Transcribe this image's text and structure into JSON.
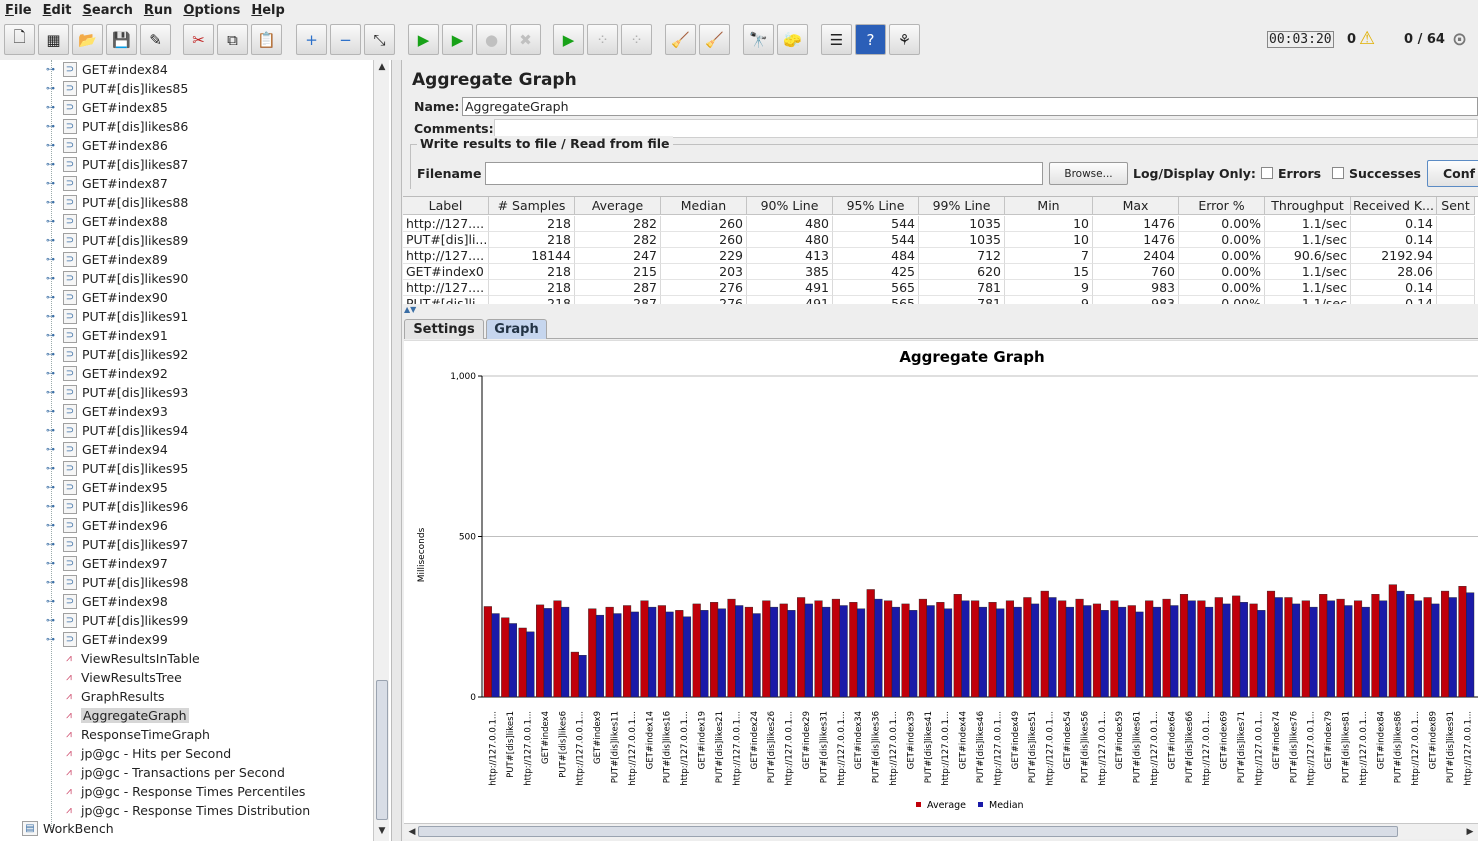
{
  "menu": [
    "File",
    "Edit",
    "Search",
    "Run",
    "Options",
    "Help"
  ],
  "toolbar": {
    "timer": "00:03:20",
    "warnings": "0",
    "threads": "0 / 64",
    "buttons": [
      {
        "name": "new-icon",
        "glyph": "🗋"
      },
      {
        "name": "templates-icon",
        "glyph": "▦"
      },
      {
        "name": "open-icon",
        "glyph": "📂"
      },
      {
        "name": "save-icon",
        "glyph": "💾"
      },
      {
        "name": "save-as-icon",
        "glyph": "✎"
      },
      {
        "name": "cut-icon",
        "glyph": "✂"
      },
      {
        "name": "copy-icon",
        "glyph": "⧉"
      },
      {
        "name": "paste-icon",
        "glyph": "📋"
      },
      {
        "name": "expand-icon",
        "glyph": "+"
      },
      {
        "name": "collapse-icon",
        "glyph": "−"
      },
      {
        "name": "toggle-icon",
        "glyph": "⤡"
      },
      {
        "name": "start-icon",
        "glyph": "▶"
      },
      {
        "name": "start-no-pause-icon",
        "glyph": "▶"
      },
      {
        "name": "stop-icon",
        "glyph": "●"
      },
      {
        "name": "shutdown-icon",
        "glyph": "✖"
      },
      {
        "name": "remote-start-icon",
        "glyph": "▶"
      },
      {
        "name": "remote-stop-icon",
        "glyph": "⁘"
      },
      {
        "name": "remote-shutdown-icon",
        "glyph": "⁘"
      },
      {
        "name": "clear-icon",
        "glyph": "🧹"
      },
      {
        "name": "clear-all-icon",
        "glyph": "🧹"
      },
      {
        "name": "search-icon",
        "glyph": "🔭"
      },
      {
        "name": "reset-search-icon",
        "glyph": "🧽"
      },
      {
        "name": "function-helper-icon",
        "glyph": "☰"
      },
      {
        "name": "help-icon",
        "glyph": "?"
      },
      {
        "name": "log-viewer-icon",
        "glyph": "⚘"
      }
    ]
  },
  "tree": {
    "items": [
      {
        "label": "GET#index84",
        "type": "sampler"
      },
      {
        "label": "PUT#[dis]likes85",
        "type": "sampler"
      },
      {
        "label": "GET#index85",
        "type": "sampler"
      },
      {
        "label": "PUT#[dis]likes86",
        "type": "sampler"
      },
      {
        "label": "GET#index86",
        "type": "sampler"
      },
      {
        "label": "PUT#[dis]likes87",
        "type": "sampler"
      },
      {
        "label": "GET#index87",
        "type": "sampler"
      },
      {
        "label": "PUT#[dis]likes88",
        "type": "sampler"
      },
      {
        "label": "GET#index88",
        "type": "sampler"
      },
      {
        "label": "PUT#[dis]likes89",
        "type": "sampler"
      },
      {
        "label": "GET#index89",
        "type": "sampler"
      },
      {
        "label": "PUT#[dis]likes90",
        "type": "sampler"
      },
      {
        "label": "GET#index90",
        "type": "sampler"
      },
      {
        "label": "PUT#[dis]likes91",
        "type": "sampler"
      },
      {
        "label": "GET#index91",
        "type": "sampler"
      },
      {
        "label": "PUT#[dis]likes92",
        "type": "sampler"
      },
      {
        "label": "GET#index92",
        "type": "sampler"
      },
      {
        "label": "PUT#[dis]likes93",
        "type": "sampler"
      },
      {
        "label": "GET#index93",
        "type": "sampler"
      },
      {
        "label": "PUT#[dis]likes94",
        "type": "sampler"
      },
      {
        "label": "GET#index94",
        "type": "sampler"
      },
      {
        "label": "PUT#[dis]likes95",
        "type": "sampler"
      },
      {
        "label": "GET#index95",
        "type": "sampler"
      },
      {
        "label": "PUT#[dis]likes96",
        "type": "sampler"
      },
      {
        "label": "GET#index96",
        "type": "sampler"
      },
      {
        "label": "PUT#[dis]likes97",
        "type": "sampler"
      },
      {
        "label": "GET#index97",
        "type": "sampler"
      },
      {
        "label": "PUT#[dis]likes98",
        "type": "sampler"
      },
      {
        "label": "GET#index98",
        "type": "sampler"
      },
      {
        "label": "PUT#[dis]likes99",
        "type": "sampler"
      },
      {
        "label": "GET#index99",
        "type": "sampler"
      },
      {
        "label": "ViewResultsInTable",
        "type": "listener"
      },
      {
        "label": "ViewResultsTree",
        "type": "listener"
      },
      {
        "label": "GraphResults",
        "type": "listener"
      },
      {
        "label": "AggregateGraph",
        "type": "listener",
        "selected": true
      },
      {
        "label": "ResponseTimeGraph",
        "type": "listener"
      },
      {
        "label": "jp@gc - Hits per Second",
        "type": "listener"
      },
      {
        "label": "jp@gc - Transactions per Second",
        "type": "listener"
      },
      {
        "label": "jp@gc - Response Times Percentiles",
        "type": "listener"
      },
      {
        "label": "jp@gc - Response Times Distribution",
        "type": "listener"
      }
    ],
    "workbench": "WorkBench"
  },
  "panel": {
    "title": "Aggregate Graph",
    "name_label": "Name:",
    "name_value": "AggregateGraph",
    "comments_label": "Comments:",
    "fileset_legend": "Write results to file / Read from file",
    "filename_label": "Filename",
    "browse_label": "Browse...",
    "log_display_label": "Log/Display Only:",
    "errors_label": "Errors",
    "successes_label": "Successes",
    "configure_label": "Conf"
  },
  "table": {
    "columns": [
      "Label",
      "# Samples",
      "Average",
      "Median",
      "90% Line",
      "95% Line",
      "99% Line",
      "Min",
      "Max",
      "Error %",
      "Throughput",
      "Received K...",
      "Sent"
    ],
    "rows": [
      [
        "http://127....",
        "218",
        "282",
        "260",
        "480",
        "544",
        "1035",
        "10",
        "1476",
        "0.00%",
        "1.1/sec",
        "0.14",
        ""
      ],
      [
        "PUT#[dis]li...",
        "218",
        "282",
        "260",
        "480",
        "544",
        "1035",
        "10",
        "1476",
        "0.00%",
        "1.1/sec",
        "0.14",
        ""
      ],
      [
        "http://127....",
        "18144",
        "247",
        "229",
        "413",
        "484",
        "712",
        "7",
        "2404",
        "0.00%",
        "90.6/sec",
        "2192.94",
        ""
      ],
      [
        "GET#index0",
        "218",
        "215",
        "203",
        "385",
        "425",
        "620",
        "15",
        "760",
        "0.00%",
        "1.1/sec",
        "28.06",
        ""
      ],
      [
        "http://127....",
        "218",
        "287",
        "276",
        "491",
        "565",
        "781",
        "9",
        "983",
        "0.00%",
        "1.1/sec",
        "0.14",
        ""
      ],
      [
        "PUT#[dis]li...",
        "218",
        "287",
        "276",
        "491",
        "565",
        "781",
        "9",
        "983",
        "0.00%",
        "1.1/sec",
        "0.14",
        ""
      ]
    ]
  },
  "tabs": [
    "Settings",
    "Graph"
  ],
  "colors": {
    "average": "#c0000a",
    "median": "#1a1aa8"
  },
  "chart_data": {
    "type": "bar",
    "title": "Aggregate Graph",
    "ylabel": "Milliseconds",
    "ylim": [
      0,
      1000
    ],
    "yticks": [
      "0",
      "500",
      "1,000"
    ],
    "grid": true,
    "legend_position": "bottom",
    "categories": [
      "http://127.0.0.1...",
      "PUT#[dis]likes1",
      "http://127.0.0.1...",
      "GET#index4",
      "PUT#[dis]likes6",
      "http://127.0.0.1...",
      "GET#index9",
      "PUT#[dis]likes11",
      "http://127.0.0.1...",
      "GET#index14",
      "PUT#[dis]likes16",
      "http://127.0.0.1...",
      "GET#index19",
      "PUT#[dis]likes21",
      "http://127.0.0.1...",
      "GET#index24",
      "PUT#[dis]likes26",
      "http://127.0.0.1...",
      "GET#index29",
      "PUT#[dis]likes31",
      "http://127.0.0.1...",
      "GET#index34",
      "PUT#[dis]likes36",
      "http://127.0.0.1...",
      "GET#index39",
      "PUT#[dis]likes41",
      "http://127.0.0.1...",
      "GET#index44",
      "PUT#[dis]likes46",
      "http://127.0.0.1...",
      "GET#index49",
      "PUT#[dis]likes51",
      "http://127.0.0.1...",
      "GET#index54",
      "PUT#[dis]likes56",
      "http://127.0.0.1...",
      "GET#index59",
      "PUT#[dis]likes61",
      "http://127.0.0.1...",
      "GET#index64",
      "PUT#[dis]likes66",
      "http://127.0.0.1...",
      "GET#index69",
      "PUT#[dis]likes71",
      "http://127.0.0.1...",
      "GET#index74",
      "PUT#[dis]likes76",
      "http://127.0.0.1...",
      "GET#index79",
      "PUT#[dis]likes81",
      "http://127.0.0.1...",
      "GET#index84",
      "PUT#[dis]likes86",
      "http://127.0.0.1...",
      "GET#index89",
      "PUT#[dis]likes91",
      "http://127.0.0.1..."
    ],
    "series": [
      {
        "name": "Average",
        "values": [
          282,
          247,
          215,
          287,
          300,
          140,
          275,
          280,
          285,
          300,
          285,
          270,
          290,
          295,
          305,
          280,
          300,
          290,
          310,
          300,
          305,
          295,
          335,
          300,
          290,
          305,
          295,
          320,
          300,
          295,
          300,
          310,
          330,
          300,
          305,
          290,
          300,
          285,
          300,
          305,
          320,
          300,
          310,
          315,
          290,
          330,
          310,
          300,
          320,
          305,
          300,
          320,
          350,
          320,
          310,
          330,
          345
        ]
      },
      {
        "name": "Median",
        "values": [
          260,
          229,
          203,
          276,
          280,
          130,
          255,
          260,
          265,
          280,
          265,
          250,
          270,
          275,
          285,
          260,
          280,
          270,
          290,
          280,
          285,
          275,
          305,
          280,
          270,
          285,
          275,
          300,
          280,
          275,
          280,
          290,
          310,
          280,
          285,
          270,
          280,
          265,
          280,
          285,
          300,
          280,
          290,
          295,
          270,
          310,
          290,
          280,
          300,
          285,
          280,
          300,
          330,
          300,
          290,
          310,
          325
        ]
      }
    ]
  }
}
